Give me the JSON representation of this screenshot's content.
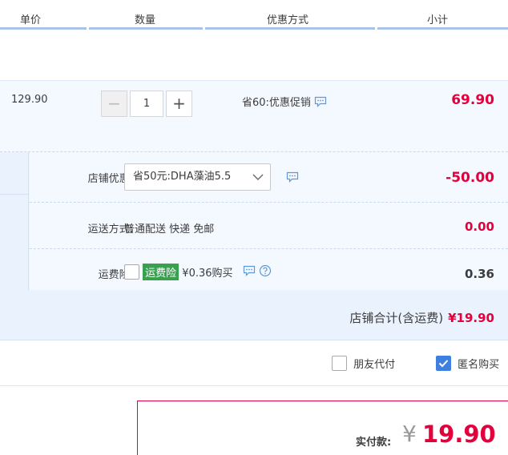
{
  "header": {
    "unit_price": "单价",
    "quantity": "数量",
    "discount": "优惠方式",
    "subtotal": "小计"
  },
  "item": {
    "price": "129.90",
    "quantity": "1",
    "minus": "−",
    "plus": "+",
    "promo": "省60:优惠促销",
    "subtotal": "69.90"
  },
  "shop": {
    "coupon_label": "店铺优惠:",
    "coupon_value": "省50元:DHA藻油5.5",
    "coupon_amount": "-50.00",
    "shipping_label": "运送方式:",
    "shipping_value": "普通配送 快递 免邮",
    "shipping_amount": "0.00",
    "insurance_label": "运费险:",
    "insurance_tag": "运费险",
    "insurance_text": "¥0.36购买",
    "insurance_amount": "0.36",
    "total_label": "店铺合计(含运费)",
    "total_value": "¥19.90"
  },
  "options": {
    "friend_pay": "朋友代付",
    "anonymous": "匿名购买",
    "anonymous_checked": true
  },
  "payment": {
    "label": "实付款:",
    "currency": "¥",
    "amount": "19.90"
  },
  "colors": {
    "price_red": "#e4003a",
    "header_line": "#a9c4e7",
    "panel_bg": "#f4f8ff",
    "tag_green": "#38a150",
    "checkbox_blue": "#3f7fe0"
  }
}
